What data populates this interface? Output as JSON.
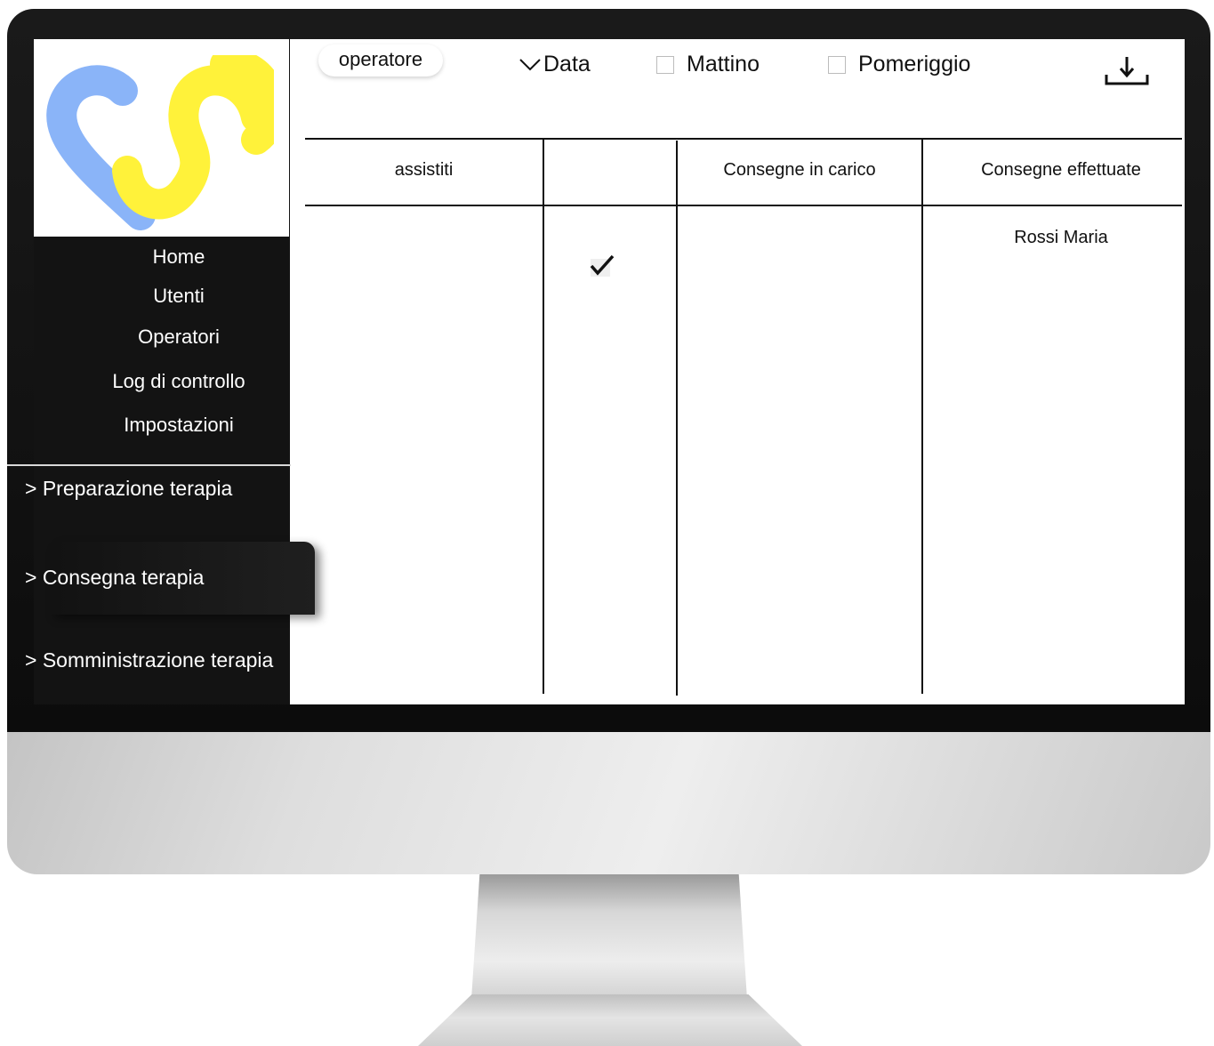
{
  "topbar": {
    "operator_label": "operatore",
    "date_label": "Data",
    "morning_label": "Mattino",
    "afternoon_label": "Pomeriggio"
  },
  "sidebar": {
    "nav": [
      {
        "label": "Home"
      },
      {
        "label": "Utenti"
      },
      {
        "label": "Operatori"
      },
      {
        "label": "Log di controllo"
      },
      {
        "label": "Impostazioni"
      }
    ],
    "sections": [
      {
        "label": "> Preparazione terapia",
        "active": false
      },
      {
        "label": "> Consegna terapia",
        "active": true
      },
      {
        "label": "> Somministrazione terapia",
        "active": false
      }
    ]
  },
  "table": {
    "headers": [
      "assistiti",
      "",
      "Consegne in carico",
      "Consegne effettuate"
    ],
    "rows": [
      {
        "assistito": "",
        "checked": true,
        "in_carico": "",
        "effettuate": "Rossi Maria"
      }
    ]
  },
  "colors": {
    "sidebar_bg": "#131313",
    "logo_blue": "#8ab4f8",
    "logo_yellow": "#fff23a"
  },
  "icons": {
    "download": "download-icon",
    "date_dropdown": "chevron-down-icon",
    "row_check": "checkmark-icon"
  }
}
